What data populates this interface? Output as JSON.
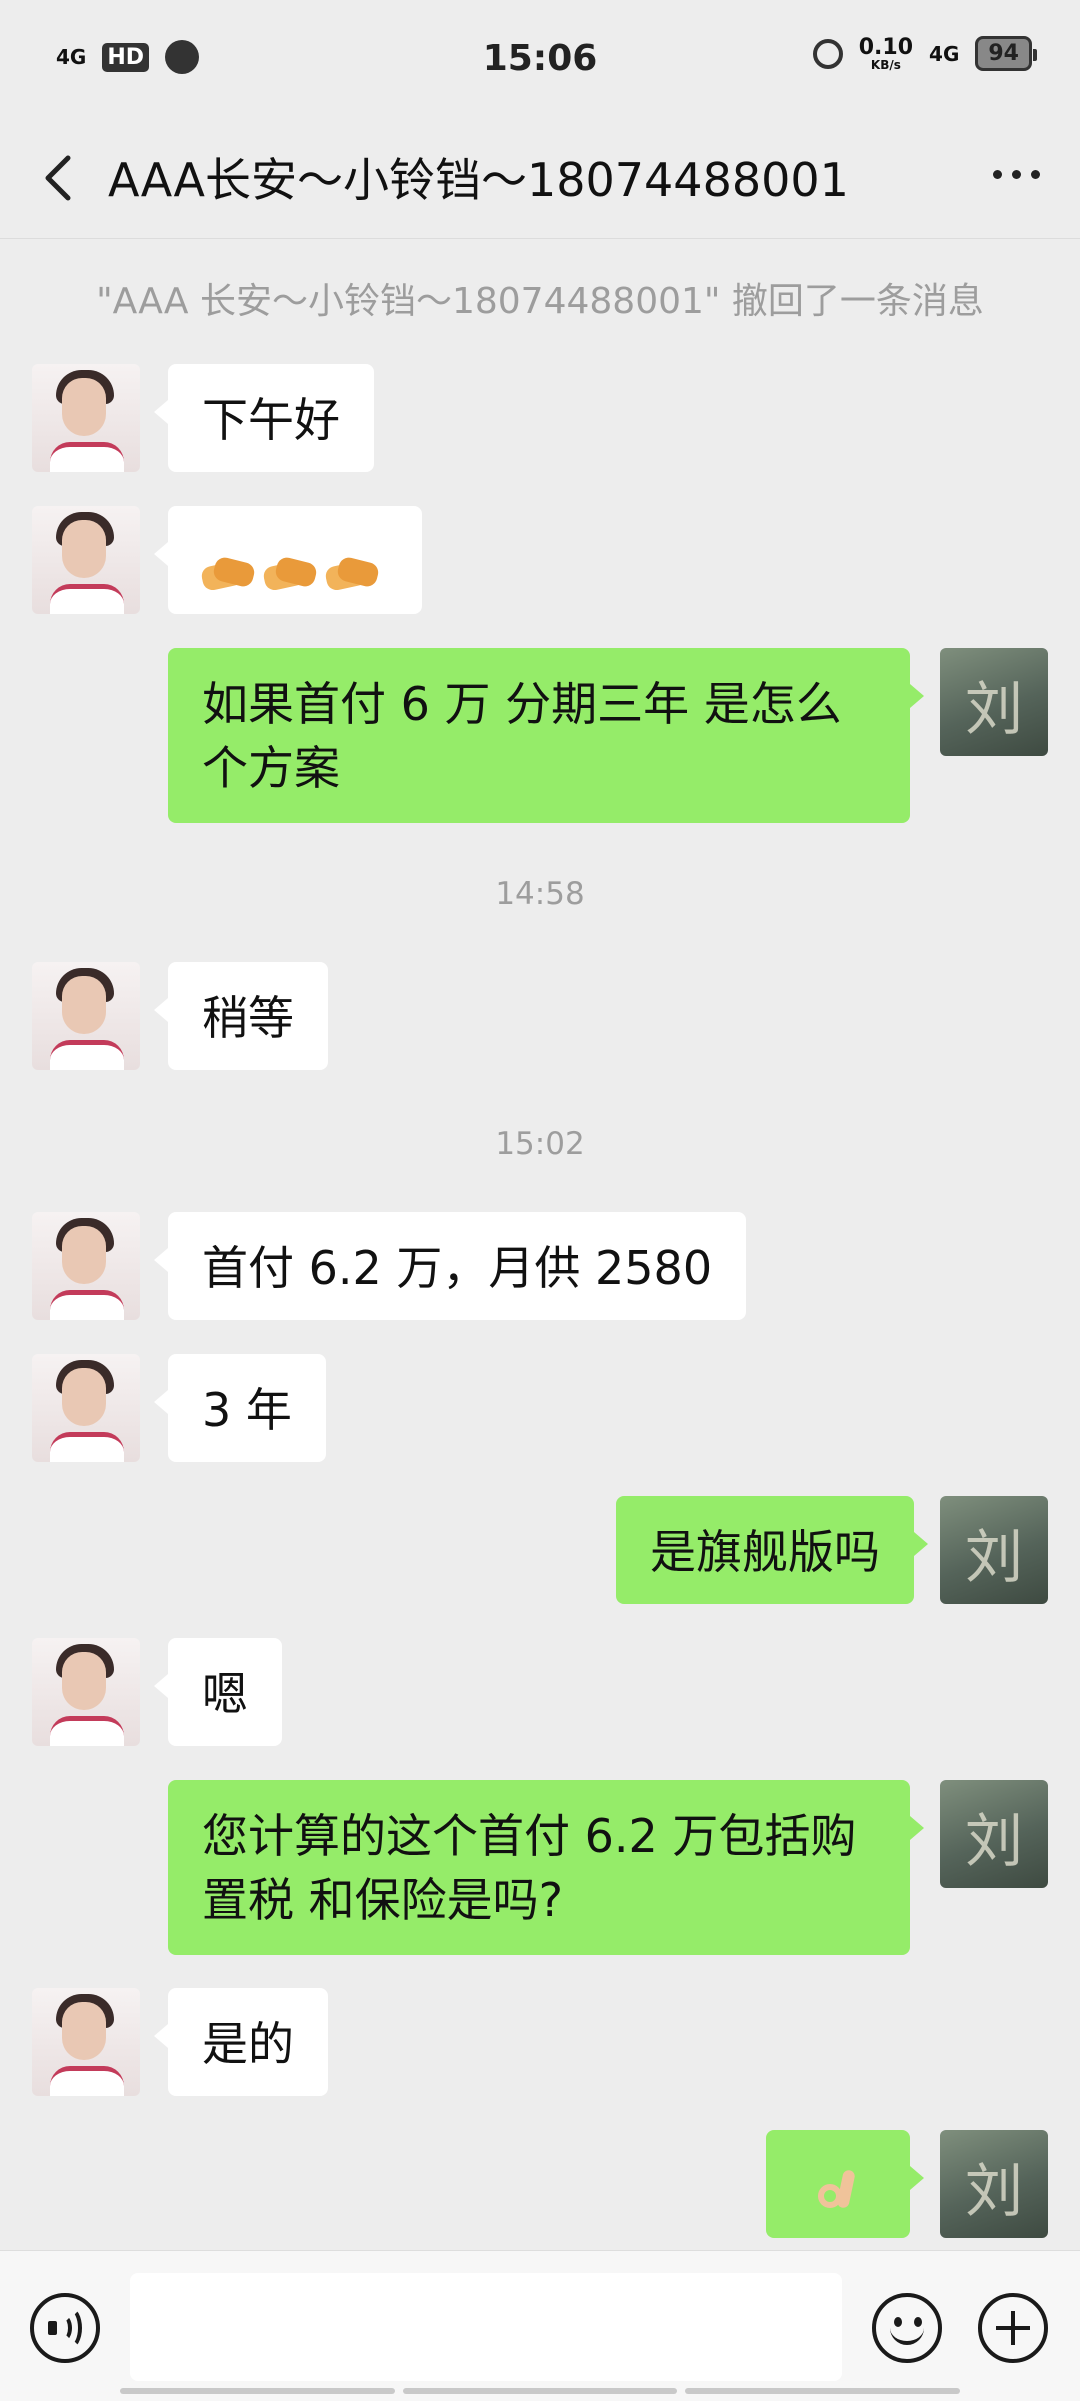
{
  "status_bar": {
    "network": "4G",
    "hd": "HD",
    "time": "15:06",
    "speed_value": "0.10",
    "speed_unit": "KB/s",
    "network_right": "4G",
    "battery": "94"
  },
  "header": {
    "title": "AAA长安～小铃铛～18074488001"
  },
  "messages": {
    "recall_notice": "\"AAA 长安～小铃铛～18074488001\" 撤回了一条消息",
    "m1": "下午好",
    "m3": "如果首付 6 万 分期三年 是怎么个方案",
    "t1": "14:58",
    "m4": "稍等",
    "t2": "15:02",
    "m5": "首付 6.2 万，月供 2580",
    "m6": "3 年",
    "m7": "是旗舰版吗",
    "m8": "嗯",
    "m9": "您计算的这个首付 6.2 万包括购置税 和保险是吗?",
    "m10": "是的"
  },
  "avatars": {
    "me_glyph": "刘"
  },
  "colors": {
    "outgoing_bubble": "#95ec69",
    "incoming_bubble": "#ffffff",
    "background": "#ededed"
  }
}
